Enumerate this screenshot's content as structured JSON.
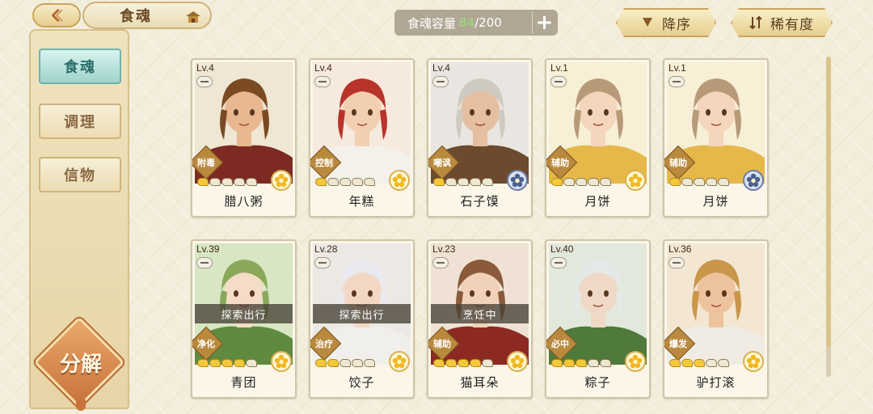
{
  "header": {
    "title": "食魂",
    "capacity_label": "食魂容量",
    "capacity_current": "84",
    "capacity_separator": "/",
    "capacity_max": "200",
    "sort_desc_label": "降序",
    "sort_rarity_label": "稀有度"
  },
  "sidebar": {
    "items": [
      {
        "label": "食魂",
        "active": true
      },
      {
        "label": "调理",
        "active": false
      },
      {
        "label": "信物",
        "active": false
      }
    ],
    "decompose_label": "分解"
  },
  "cards": [
    {
      "level": "Lv.4",
      "role": "附毒",
      "name": "腊八粥",
      "stars": 1,
      "flower": "gold",
      "status": "",
      "hair": "#7a4a22",
      "skin": "#e8b891",
      "cloth": "#7d2a22",
      "bg": "#efe6d4"
    },
    {
      "level": "Lv.4",
      "role": "控制",
      "name": "年糕",
      "stars": 1,
      "flower": "gold",
      "status": "",
      "hair": "#b8332a",
      "skin": "#f3cfb2",
      "cloth": "#f4f1ea",
      "bg": "#f6e9de"
    },
    {
      "level": "Lv.4",
      "role": "嘲讽",
      "name": "石子馍",
      "stars": 1,
      "flower": "blue",
      "status": "",
      "hair": "#cfcac0",
      "skin": "#e5bf9f",
      "cloth": "#6b4a2e",
      "bg": "#e9e6e2"
    },
    {
      "level": "Lv.1",
      "role": "辅助",
      "name": "月饼",
      "stars": 1,
      "flower": "gold",
      "status": "",
      "hair": "#b89a78",
      "skin": "#f4d6bd",
      "cloth": "#e6b84a",
      "bg": "#f7efd6"
    },
    {
      "level": "Lv.1",
      "role": "辅助",
      "name": "月饼",
      "stars": 1,
      "flower": "blue",
      "status": "",
      "hair": "#b89a78",
      "skin": "#f4d6bd",
      "cloth": "#e6b84a",
      "bg": "#f7efd6"
    },
    {
      "level": "Lv.39",
      "role": "净化",
      "name": "青团",
      "stars": 4,
      "flower": "gold",
      "status": "探索出行",
      "hair": "#8aa85a",
      "skin": "#f4dcc6",
      "cloth": "#5f8a3f",
      "bg": "#d8e6c4"
    },
    {
      "level": "Lv.28",
      "role": "治疗",
      "name": "饺子",
      "stars": 2,
      "flower": "gold",
      "status": "探索出行",
      "hair": "#e9e9ef",
      "skin": "#f2d8c4",
      "cloth": "#f1efec",
      "bg": "#ece8e4"
    },
    {
      "level": "Lv.23",
      "role": "辅助",
      "name": "猫耳朵",
      "stars": 4,
      "flower": "gold",
      "status": "烹饪中",
      "hair": "#8a5a3a",
      "skin": "#f1d1b7",
      "cloth": "#8c2a22",
      "bg": "#efe2d4"
    },
    {
      "level": "Lv.40",
      "role": "必中",
      "name": "粽子",
      "stars": 3,
      "flower": "gold",
      "status": "",
      "hair": "#e4e8e6",
      "skin": "#f0d8c6",
      "cloth": "#4f7a3a",
      "bg": "#e2e8dc"
    },
    {
      "level": "Lv.36",
      "role": "爆发",
      "name": "驴打滚",
      "stars": 3,
      "flower": "gold",
      "status": "",
      "hair": "#c9964a",
      "skin": "#edc39e",
      "cloth": "#f0ece4",
      "bg": "#f3e6d2"
    }
  ],
  "colors": {
    "accent_teal": "#6fb3ab",
    "gold": "#f3c83a",
    "capacity_green": "#9be07a"
  }
}
